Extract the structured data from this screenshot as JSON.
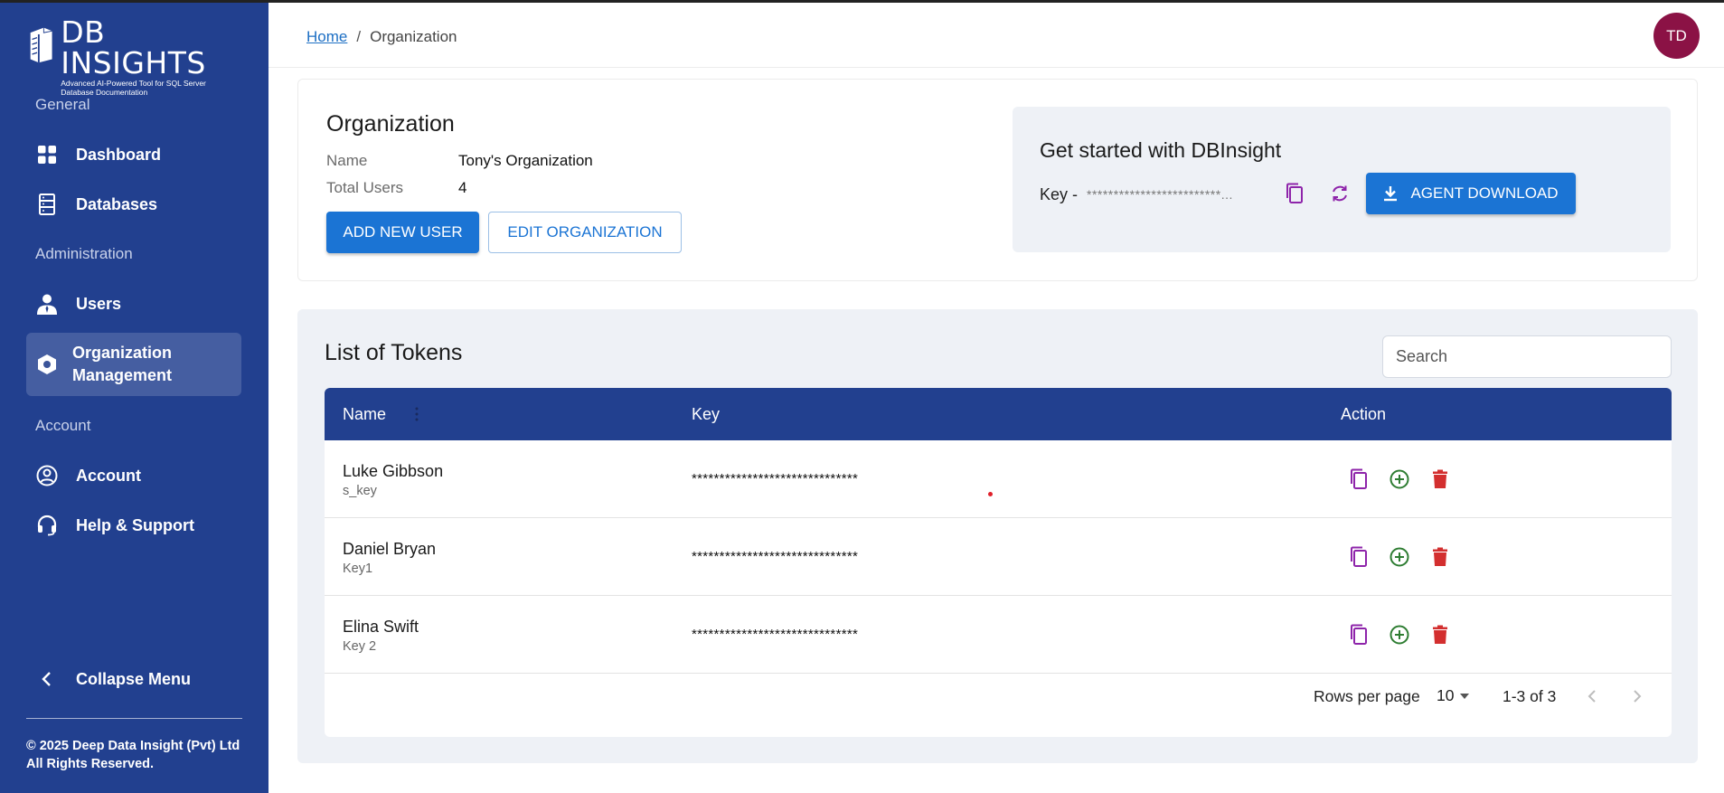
{
  "brand": {
    "title": "DB INSIGHTS",
    "subtitle_line1": "Advanced AI-Powered Tool for SQL Server",
    "subtitle_line2": "Database Documentation"
  },
  "sidebar": {
    "sections": [
      {
        "label": "General"
      },
      {
        "label": "Administration"
      },
      {
        "label": "Account"
      }
    ],
    "items": [
      {
        "label": "Dashboard",
        "icon": "dashboard-icon"
      },
      {
        "label": "Databases",
        "icon": "database-icon"
      },
      {
        "label": "Users",
        "icon": "user-icon"
      },
      {
        "label": "Organization Management",
        "icon": "organization-icon",
        "active": true
      },
      {
        "label": "Account",
        "icon": "account-circle-icon"
      },
      {
        "label": "Help & Support",
        "icon": "headset-icon"
      }
    ],
    "collapse_label": "Collapse Menu",
    "footer_line1": "© 2025 Deep Data Insight (Pvt) Ltd",
    "footer_line2": "All Rights Reserved."
  },
  "topbar": {
    "breadcrumb_home": "Home",
    "breadcrumb_sep": "/",
    "breadcrumb_current": "Organization",
    "avatar_initials": "TD",
    "avatar_color": "#8b1245"
  },
  "organization": {
    "title": "Organization",
    "name_label": "Name",
    "name_value": "Tony's Organization",
    "users_label": "Total Users",
    "users_value": "4",
    "add_user_label": "ADD NEW USER",
    "edit_org_label": "EDIT ORGANIZATION"
  },
  "get_started": {
    "title": "Get started with DBInsight",
    "key_label": "Key -",
    "key_value": "*************************...",
    "download_label": "AGENT DOWNLOAD"
  },
  "tokens": {
    "title": "List of Tokens",
    "search_placeholder": "Search",
    "columns": [
      "Name",
      "Key",
      "Action"
    ],
    "rows": [
      {
        "name": "Luke Gibbson",
        "sub": "s_key",
        "key": "******************************"
      },
      {
        "name": "Daniel Bryan",
        "sub": "Key1",
        "key": "******************************"
      },
      {
        "name": "Elina Swift",
        "sub": "Key 2",
        "key": "******************************"
      }
    ],
    "rows_per_page_label": "Rows per page",
    "rows_per_page_value": "10",
    "range_label": "1-3 of 3"
  },
  "colors": {
    "sidebar_bg": "#22408f",
    "primary": "#1b74d4",
    "copy_icon": "#8e24aa",
    "add_icon": "#2e7d32",
    "delete_icon": "#d32f2f"
  }
}
